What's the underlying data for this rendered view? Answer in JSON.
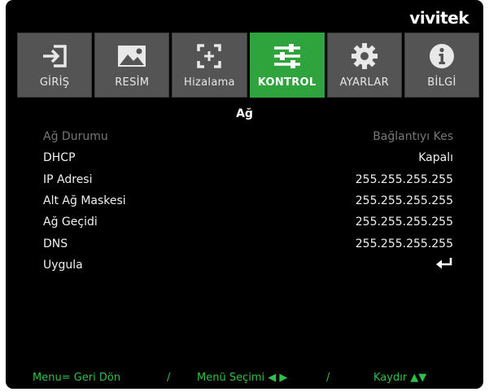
{
  "brand": "vivitek",
  "tabs": [
    {
      "label": "GİRİŞ",
      "icon": "input-icon",
      "active": false
    },
    {
      "label": "RESİM",
      "icon": "image-icon",
      "active": false
    },
    {
      "label": "Hizalama",
      "icon": "alignment-icon",
      "active": false
    },
    {
      "label": "KONTROL",
      "icon": "sliders-icon",
      "active": true
    },
    {
      "label": "AYARLAR",
      "icon": "gear-icon",
      "active": false
    },
    {
      "label": "BİLGİ",
      "icon": "info-icon",
      "active": false
    }
  ],
  "page_title": "Ağ",
  "rows": [
    {
      "label": "Ağ Durumu",
      "value": "Bağlantıyı Kes",
      "disabled": true
    },
    {
      "label": "DHCP",
      "value": "Kapalı",
      "disabled": false
    },
    {
      "label": "IP Adresi",
      "value": "255.255.255.255",
      "disabled": false
    },
    {
      "label": "Alt Ağ Maskesi",
      "value": "255.255.255.255",
      "disabled": false
    },
    {
      "label": "Ağ Geçidi",
      "value": "255.255.255.255",
      "disabled": false
    },
    {
      "label": "DNS",
      "value": "255.255.255.255",
      "disabled": false
    },
    {
      "label": "Uygula",
      "value": "",
      "icon": "enter-icon",
      "disabled": false
    }
  ],
  "footer": {
    "back": "Menu= Geri Dön",
    "select": "Menü Seçimi ◀ ▶",
    "scroll": "Kaydır ▲▼",
    "separator": "/"
  },
  "colors": {
    "active_tab": "#2fa43c",
    "tab_bg": "#545454",
    "footer_text": "#2fc04a",
    "disabled_text": "#777777"
  }
}
